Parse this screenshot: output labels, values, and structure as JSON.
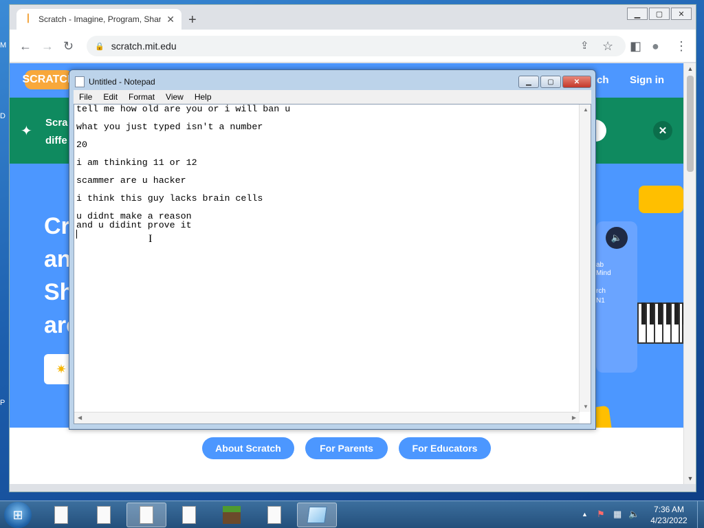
{
  "desktop": {
    "glyphs": [
      "M",
      "D",
      "P"
    ]
  },
  "browser": {
    "tab_title": "Scratch - Imagine, Program, Share",
    "tab_close": "✕",
    "new_tab": "+",
    "win_min": "▁",
    "win_max": "▢",
    "win_close": "✕",
    "back": "←",
    "forward": "→",
    "reload": "↻",
    "url": "scratch.mit.edu",
    "share": "⇪",
    "bookmark": "☆",
    "sidepanel": "◧",
    "profile": "●",
    "menu": "⋮"
  },
  "scratch": {
    "logo": "SCRATCH",
    "nav_search": "ch",
    "nav_signin": "Sign in",
    "banner_line1": "Scra",
    "banner_line2": "diffe",
    "banner_close": "✕",
    "hero_lines": [
      "Cr",
      "an",
      "Sh",
      "are"
    ],
    "art_labels": [
      "ab",
      "Mind",
      "rch",
      "N1"
    ],
    "footer_buttons": [
      "About Scratch",
      "For Parents",
      "For Educators"
    ]
  },
  "notepad": {
    "title": "Untitled - Notepad",
    "menu": [
      "File",
      "Edit",
      "Format",
      "View",
      "Help"
    ],
    "lines": [
      "tell me how old are you or i will ban u",
      "",
      "what you just typed isn't a number",
      "",
      "20",
      "",
      "i am thinking 11 or 12",
      "",
      "scammer are u hacker",
      "",
      "i think this guy lacks brain cells",
      "",
      "u didnt make a reason",
      "and u didint prove it",
      ""
    ]
  },
  "taskbar": {
    "time": "7:36 AM",
    "date": "4/23/2022"
  }
}
